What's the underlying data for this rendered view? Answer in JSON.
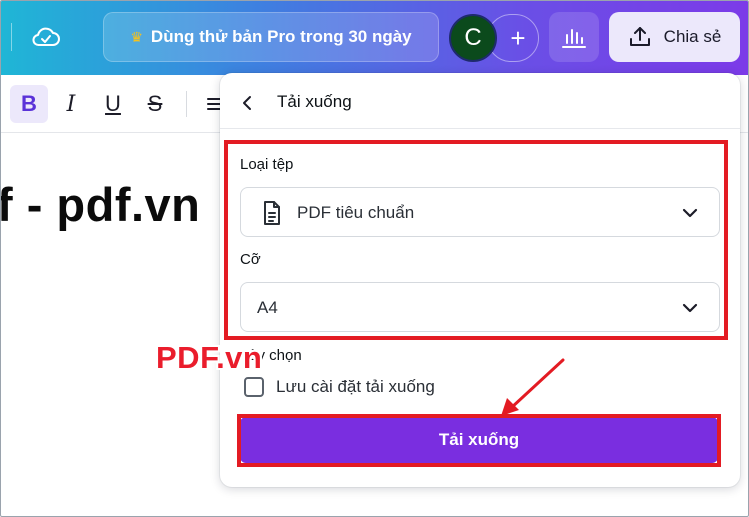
{
  "header": {
    "pro_label": "Dùng thử bản Pro trong 30 ngày",
    "avatar_initial": "C",
    "add_symbol": "+",
    "share_label": "Chia sẻ",
    "icons": [
      "cloud-check-icon",
      "crown-icon",
      "plus-icon",
      "bar-chart-icon",
      "upload-icon"
    ]
  },
  "toolbar": {
    "bold": "B",
    "italic": "I",
    "underline": "U",
    "strikethrough": "S",
    "icons": [
      "list-icon"
    ]
  },
  "document": {
    "text": "f - pdf.vn"
  },
  "panel": {
    "title": "Tải xuống",
    "file_type_label": "Loại tệp",
    "file_type_value": "PDF tiêu chuẩn",
    "size_label": "Cỡ",
    "size_value": "A4",
    "options_label": "Tùy chọn",
    "save_settings_label": "Lưu cài đặt tải xuống",
    "save_settings_checked": false,
    "download_label": "Tải xuống",
    "icons": [
      "chevron-left-icon",
      "file-document-icon",
      "chevron-down-icon"
    ]
  },
  "watermark": "PDF.vn",
  "colors": {
    "accent": "#7a2ee0",
    "highlight": "#e31b23",
    "avatar_bg": "#0b4a1c"
  }
}
